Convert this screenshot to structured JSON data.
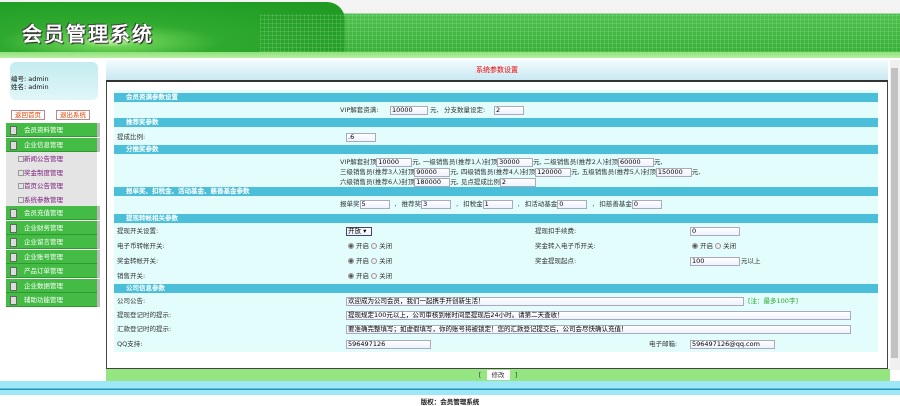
{
  "header": {
    "title": "会员管理系统"
  },
  "user": {
    "id_label": "编号:",
    "id": "admin",
    "name_label": "姓名:",
    "name": "admin"
  },
  "buttons": {
    "home": "返回首页",
    "logout": "退出系统",
    "submit": "修改",
    "bracket_l": "[",
    "bracket_r": "]"
  },
  "menu": [
    {
      "label": "会员资料管理"
    },
    {
      "label": "企业信息管理"
    },
    {
      "label": "新闻公告管理",
      "sub": true
    },
    {
      "label": "奖金制度管理",
      "sub": true
    },
    {
      "label": "首页公告管理",
      "sub": true
    },
    {
      "label": "系统参数管理",
      "sub": true
    },
    {
      "label": "会员充值管理"
    },
    {
      "label": "企业财务管理"
    },
    {
      "label": "企业留言管理"
    },
    {
      "label": "企业账号管理"
    },
    {
      "label": "产品订单管理"
    },
    {
      "label": "企业数据管理"
    },
    {
      "label": "辅助功能管理"
    }
  ],
  "main": {
    "title": "系统参数设置"
  },
  "s1": {
    "title": "会员资满参数设置",
    "vip_label": "VIP解套资满:",
    "vip": "10000",
    "unit": "元,",
    "split_label": "分支数量设定:",
    "split": "2"
  },
  "s2": {
    "title": "推荐奖参数",
    "ratio_label": "提成比例:",
    "ratio": ".6"
  },
  "s3": {
    "title": "分推奖参数",
    "r1": [
      "VIP解套封顶",
      "10000",
      "元,  一级销售员(推荐1人)封顶",
      "30000",
      "元,  二级销售员(推荐2人)封顶",
      "60000",
      "元,"
    ],
    "r2": [
      "三级销售员(推荐3人)封顶",
      "90000",
      "元,  四级销售员(推荐4人)封顶",
      "120000",
      "元,  五级销售员(推荐5人)封顶",
      "150000",
      "元,"
    ],
    "r3": [
      "六级销售员(推荐6人)封顶",
      "180000",
      "元,  见点提成比例",
      "2"
    ]
  },
  "s4": {
    "title": "报单奖、扣税金、活动基金、慈善基金参数",
    "items": [
      [
        "报单奖",
        "5",
        ","
      ],
      [
        "推荐奖",
        "3",
        ","
      ],
      [
        "扣税金",
        "1",
        ","
      ],
      [
        "扣活动基金",
        "0",
        ","
      ],
      [
        "扣慈善基金",
        "0",
        ""
      ]
    ]
  },
  "s5": {
    "title": "提现转帐相关参数",
    "switch_label": "提现开关设置:",
    "switch": "开放",
    "fee_label": "提现扣手续费:",
    "fee": "0",
    "ecoin_label": "电子币转帐开关:",
    "bonus2coin_label": "奖金转入电子币开关:",
    "bonus_label": "奖金转帐开关:",
    "min_label": "奖金提现起点:",
    "min": "100",
    "min_unit": "元以上",
    "sales_label": "销售开关:",
    "on": "开启",
    "off": "关闭"
  },
  "s6": {
    "title": "公司信息参数",
    "notice_label": "公司公告:",
    "notice": "欢迎成为公司会员，我们一起携手开创新生活！",
    "notice_hint": "[注：最多100字]",
    "wd_label": "提现登记时的提示:",
    "wd": "提现规定100元以上，公司审核到帐时间是提现后24小时。请第二天查收！",
    "remit_label": "汇款登记时的提示:",
    "remit": "要准确完整填写；如虚假填写，你的账号将被锁定！您的汇款登记提交后，公司会尽快确认充值！",
    "qq_label": "QQ支持:",
    "qq": "596497126",
    "email_label": "电子邮箱:",
    "email": "596497126@qq.com"
  },
  "footer": {
    "text": "版权：会员管理系统"
  }
}
